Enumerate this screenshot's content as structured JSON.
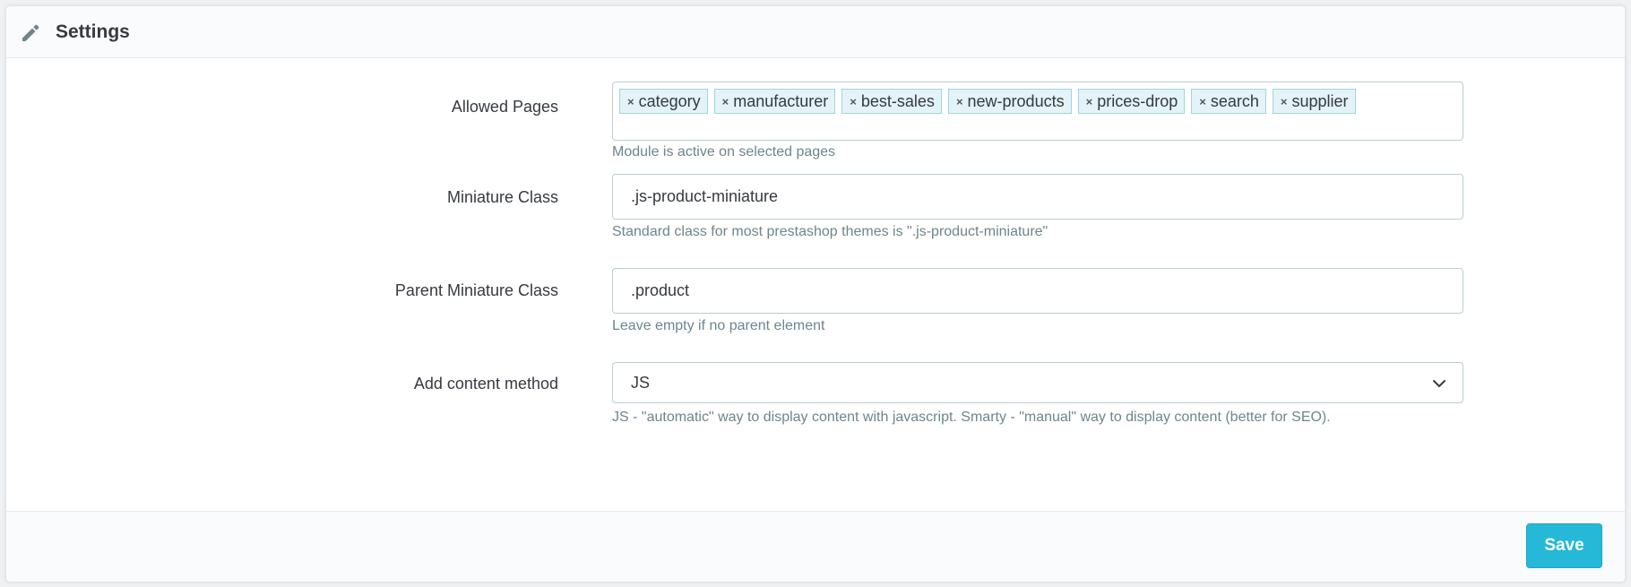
{
  "panel": {
    "title": "Settings",
    "icon": "pencil-icon"
  },
  "form": {
    "allowed_pages": {
      "label": "Allowed Pages",
      "tags": [
        "category",
        "manufacturer",
        "best-sales",
        "new-products",
        "prices-drop",
        "search",
        "supplier"
      ],
      "remove_glyph": "×",
      "help": "Module is active on selected pages"
    },
    "miniature_class": {
      "label": "Miniature Class",
      "value": ".js-product-miniature",
      "help": "Standard class for most prestashop themes is \".js-product-miniature\""
    },
    "parent_miniature_class": {
      "label": "Parent Miniature Class",
      "value": ".product",
      "help": "Leave empty if no parent element"
    },
    "add_content_method": {
      "label": "Add content method",
      "selected": "JS",
      "icon": "chevron-down-icon",
      "help": "JS - \"automatic\" way to display content with javascript. Smarty - \"manual\" way to display content (better for SEO)."
    }
  },
  "footer": {
    "save_label": "Save"
  },
  "colors": {
    "accent": "#25b9d7",
    "tag_bg": "#e3f3f7",
    "help_text": "#6c868e"
  }
}
